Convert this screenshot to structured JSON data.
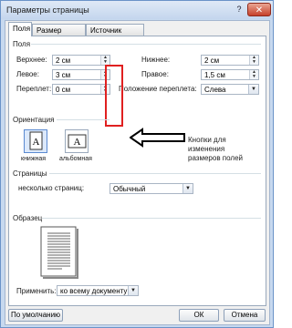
{
  "window": {
    "title": "Параметры страницы",
    "help": "?",
    "close": "✕"
  },
  "tabs": [
    "Поля",
    "Размер бумаги",
    "Источник бумаги"
  ],
  "fields_section": {
    "title": "Поля",
    "top": {
      "label": "Верхнее:",
      "value": "2 см"
    },
    "bottom": {
      "label": "Нижнее:",
      "value": "2 см"
    },
    "left": {
      "label": "Левое:",
      "value": "3 см"
    },
    "right": {
      "label": "Правое:",
      "value": "1,5 см"
    },
    "gutter": {
      "label": "Переплет:",
      "value": "0 см"
    },
    "gutter_position": {
      "label": "Положение переплета:",
      "value": "Слева"
    }
  },
  "annotation": {
    "text_lines": [
      "Кнопки для",
      "изменения",
      "размеров полей"
    ],
    "color": "#e02020"
  },
  "orientation": {
    "title": "Ориентация",
    "portrait": "книжная",
    "landscape": "альбомная",
    "glyph": "A"
  },
  "pages": {
    "title": "Страницы",
    "label": "несколько страниц:",
    "value": "Обычный"
  },
  "sample": {
    "title": "Образец"
  },
  "apply": {
    "label": "Применить:",
    "value": "ко всему документу"
  },
  "buttons": {
    "default": "По умолчанию",
    "ok": "ОК",
    "cancel": "Отмена"
  }
}
